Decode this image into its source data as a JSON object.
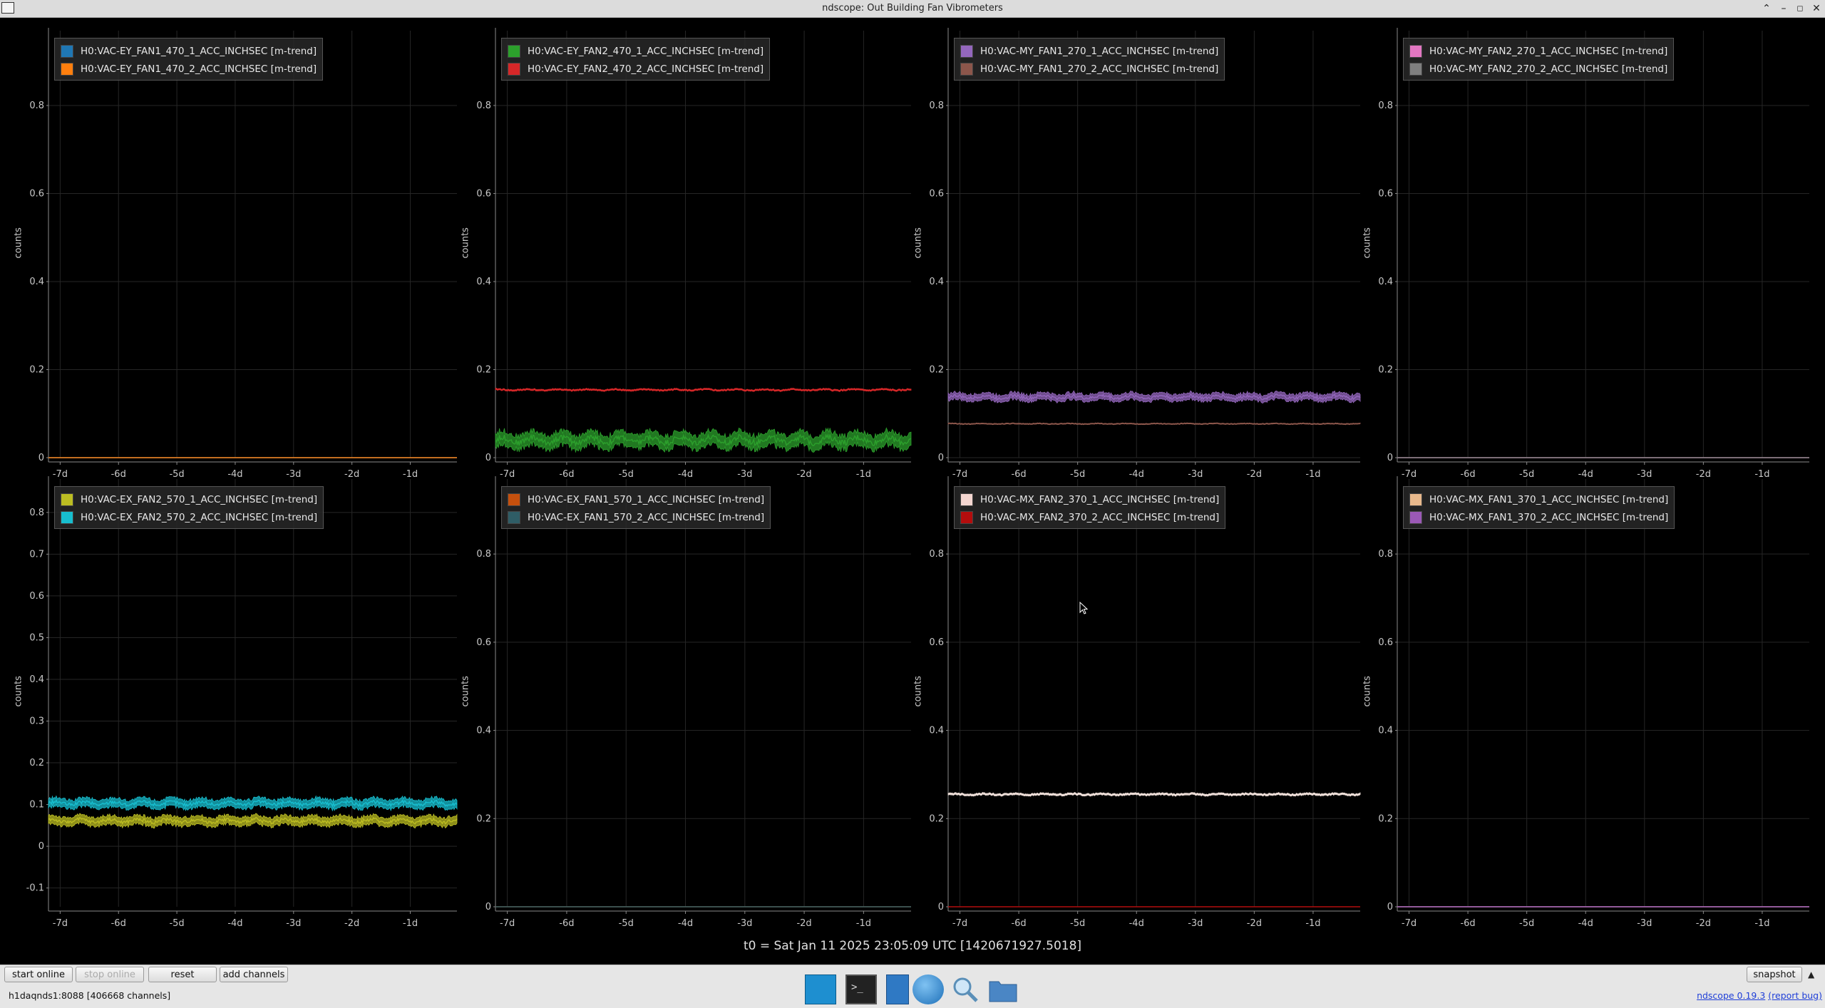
{
  "window": {
    "title": "ndscope: Out Building Fan Vibrometers"
  },
  "plots": [
    {
      "id": "p1",
      "ylabel": "counts",
      "ylim": [
        0,
        0.97
      ],
      "yticks": [
        0,
        0.2,
        0.4,
        0.6,
        0.8
      ],
      "legend": [
        {
          "label": "H0:VAC-EY_FAN1_470_1_ACC_INCHSEC [m-trend]",
          "color": "#1f77b4"
        },
        {
          "label": "H0:VAC-EY_FAN1_470_2_ACC_INCHSEC [m-trend]",
          "color": "#ff7f0e"
        }
      ],
      "series": [
        {
          "color": "#1f77b4",
          "mean": 0.0,
          "noise": 0.0,
          "thick": 0
        },
        {
          "color": "#ff7f0e",
          "mean": 0.0,
          "noise": 0.0,
          "thick": 0
        }
      ]
    },
    {
      "id": "p2",
      "ylabel": "counts",
      "ylim": [
        0,
        0.97
      ],
      "yticks": [
        0,
        0.2,
        0.4,
        0.6,
        0.8
      ],
      "legend": [
        {
          "label": "H0:VAC-EY_FAN2_470_1_ACC_INCHSEC [m-trend]",
          "color": "#2ca02c"
        },
        {
          "label": "H0:VAC-EY_FAN2_470_2_ACC_INCHSEC [m-trend]",
          "color": "#d62728"
        }
      ],
      "series": [
        {
          "color": "#2ca02c",
          "mean": 0.04,
          "noise": 0.01,
          "thick": 0.03
        },
        {
          "color": "#d62728",
          "mean": 0.154,
          "noise": 0.002,
          "thick": 0.003
        }
      ]
    },
    {
      "id": "p3",
      "ylabel": "counts",
      "ylim": [
        0,
        0.97
      ],
      "yticks": [
        0,
        0.2,
        0.4,
        0.6,
        0.8
      ],
      "legend": [
        {
          "label": "H0:VAC-MY_FAN1_270_1_ACC_INCHSEC [m-trend]",
          "color": "#9467bd"
        },
        {
          "label": "H0:VAC-MY_FAN1_270_2_ACC_INCHSEC [m-trend]",
          "color": "#8c564b"
        }
      ],
      "series": [
        {
          "color": "#9467bd",
          "mean": 0.138,
          "noise": 0.005,
          "thick": 0.015
        },
        {
          "color": "#8c564b",
          "mean": 0.077,
          "noise": 0.001,
          "thick": 0.002
        }
      ]
    },
    {
      "id": "p4",
      "ylabel": "counts",
      "ylim": [
        0,
        0.97
      ],
      "yticks": [
        0,
        0.2,
        0.4,
        0.6,
        0.8
      ],
      "legend": [
        {
          "label": "H0:VAC-MY_FAN2_270_1_ACC_INCHSEC [m-trend]",
          "color": "#e377c2"
        },
        {
          "label": "H0:VAC-MY_FAN2_270_2_ACC_INCHSEC [m-trend]",
          "color": "#7f7f7f"
        }
      ],
      "series": [
        {
          "color": "#e377c2",
          "mean": 0.0,
          "noise": 0.0,
          "thick": 0
        },
        {
          "color": "#7f7f7f",
          "mean": 0.0,
          "noise": 0.0,
          "thick": 0
        }
      ]
    },
    {
      "id": "p5",
      "ylabel": "counts",
      "ylim": [
        -0.145,
        0.88
      ],
      "yticks": [
        -0.1,
        0,
        0.1,
        0.2,
        0.3,
        0.4,
        0.5,
        0.6,
        0.7,
        0.8
      ],
      "legend": [
        {
          "label": "H0:VAC-EX_FAN2_570_1_ACC_INCHSEC [m-trend]",
          "color": "#bcbd22"
        },
        {
          "label": "H0:VAC-EX_FAN2_570_2_ACC_INCHSEC [m-trend]",
          "color": "#17becf"
        }
      ],
      "series": [
        {
          "color": "#17becf",
          "mean": 0.103,
          "noise": 0.006,
          "thick": 0.02
        },
        {
          "color": "#bcbd22",
          "mean": 0.061,
          "noise": 0.006,
          "thick": 0.02
        }
      ]
    },
    {
      "id": "p6",
      "ylabel": "counts",
      "ylim": [
        0,
        0.97
      ],
      "yticks": [
        0,
        0.2,
        0.4,
        0.6,
        0.8
      ],
      "legend": [
        {
          "label": "H0:VAC-EX_FAN1_570_1_ACC_INCHSEC [m-trend]",
          "color": "#c5500d"
        },
        {
          "label": "H0:VAC-EX_FAN1_570_2_ACC_INCHSEC [m-trend]",
          "color": "#2f5d66"
        }
      ],
      "series": [
        {
          "color": "#c5500d",
          "mean": 0.0,
          "noise": 0.0,
          "thick": 0
        },
        {
          "color": "#2f5d66",
          "mean": 0.0,
          "noise": 0.0,
          "thick": 0
        }
      ]
    },
    {
      "id": "p7",
      "ylabel": "counts",
      "ylim": [
        0,
        0.97
      ],
      "yticks": [
        0,
        0.2,
        0.4,
        0.6,
        0.8
      ],
      "legend": [
        {
          "label": "H0:VAC-MX_FAN2_370_1_ACC_INCHSEC [m-trend]",
          "color": "#f4d6d0"
        },
        {
          "label": "H0:VAC-MX_FAN2_370_2_ACC_INCHSEC [m-trend]",
          "color": "#b30d0d"
        }
      ],
      "series": [
        {
          "color": "#f0e0da",
          "mean": 0.255,
          "noise": 0.002,
          "thick": 0.004
        },
        {
          "color": "#b30d0d",
          "mean": 0.0,
          "noise": 0.0,
          "thick": 0
        }
      ]
    },
    {
      "id": "p8",
      "ylabel": "counts",
      "ylim": [
        0,
        0.97
      ],
      "yticks": [
        0,
        0.2,
        0.4,
        0.6,
        0.8
      ],
      "legend": [
        {
          "label": "H0:VAC-MX_FAN1_370_1_ACC_INCHSEC [m-trend]",
          "color": "#e8b98c"
        },
        {
          "label": "H0:VAC-MX_FAN1_370_2_ACC_INCHSEC [m-trend]",
          "color": "#9b59b6"
        }
      ],
      "series": [
        {
          "color": "#e8b98c",
          "mean": 0.0,
          "noise": 0.0,
          "thick": 0
        },
        {
          "color": "#9b59b6",
          "mean": 0.0,
          "noise": 0.0,
          "thick": 0
        }
      ]
    }
  ],
  "xaxis": {
    "ticks": [
      "-7d",
      "-6d",
      "-5d",
      "-4d",
      "-3d",
      "-2d",
      "-1d"
    ],
    "tick_days": [
      -7,
      -6,
      -5,
      -4,
      -3,
      -2,
      -1
    ],
    "xlim_days": [
      -7.2,
      -0.2
    ]
  },
  "t0_label": "t0 = Sat Jan 11 2025 23:05:09 UTC [1420671927.5018]",
  "buttons": {
    "start_online": "start online",
    "stop_online": "stop online",
    "reset": "reset",
    "add_channels": "add channels",
    "snapshot": "snapshot"
  },
  "status": {
    "server": "h1daqnds1:8088",
    "channels": "[406668 channels]"
  },
  "version": {
    "link": "ndscope 0.19.3",
    "report": "(report bug)"
  },
  "taskbar": [
    "desktop-icon",
    "terminal-icon",
    "text-editor-icon",
    "browser-icon",
    "search-icon",
    "folder-icon"
  ]
}
